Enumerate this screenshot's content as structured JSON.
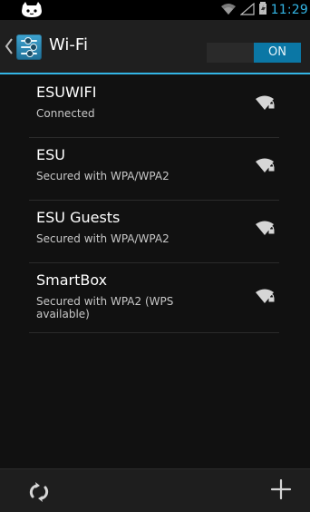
{
  "status_bar": {
    "time": "11:29",
    "icons": {
      "left": "android-cat-icon",
      "right": [
        "wifi-signal-icon",
        "cell-signal-icon",
        "battery-charging-icon"
      ]
    }
  },
  "header": {
    "title": "Wi-Fi",
    "toggle": {
      "label": "ON"
    }
  },
  "networks": [
    {
      "ssid": "ESUWIFI",
      "status": "Connected",
      "icon": "wifi-locked-icon"
    },
    {
      "ssid": "ESU",
      "status": "Secured with WPA/WPA2",
      "icon": "wifi-locked-icon"
    },
    {
      "ssid": "ESU Guests",
      "status": "Secured with WPA/WPA2",
      "icon": "wifi-locked-icon"
    },
    {
      "ssid": "SmartBox",
      "status": "Secured with WPA2 (WPS available)",
      "icon": "wifi-locked-icon"
    }
  ],
  "bottom_bar": {
    "scan_icon": "scan-refresh-icon",
    "add_icon": "add-network-icon"
  },
  "colors": {
    "accent": "#33b5e5",
    "toggle_on": "#0b77a5",
    "background": "#111111"
  }
}
